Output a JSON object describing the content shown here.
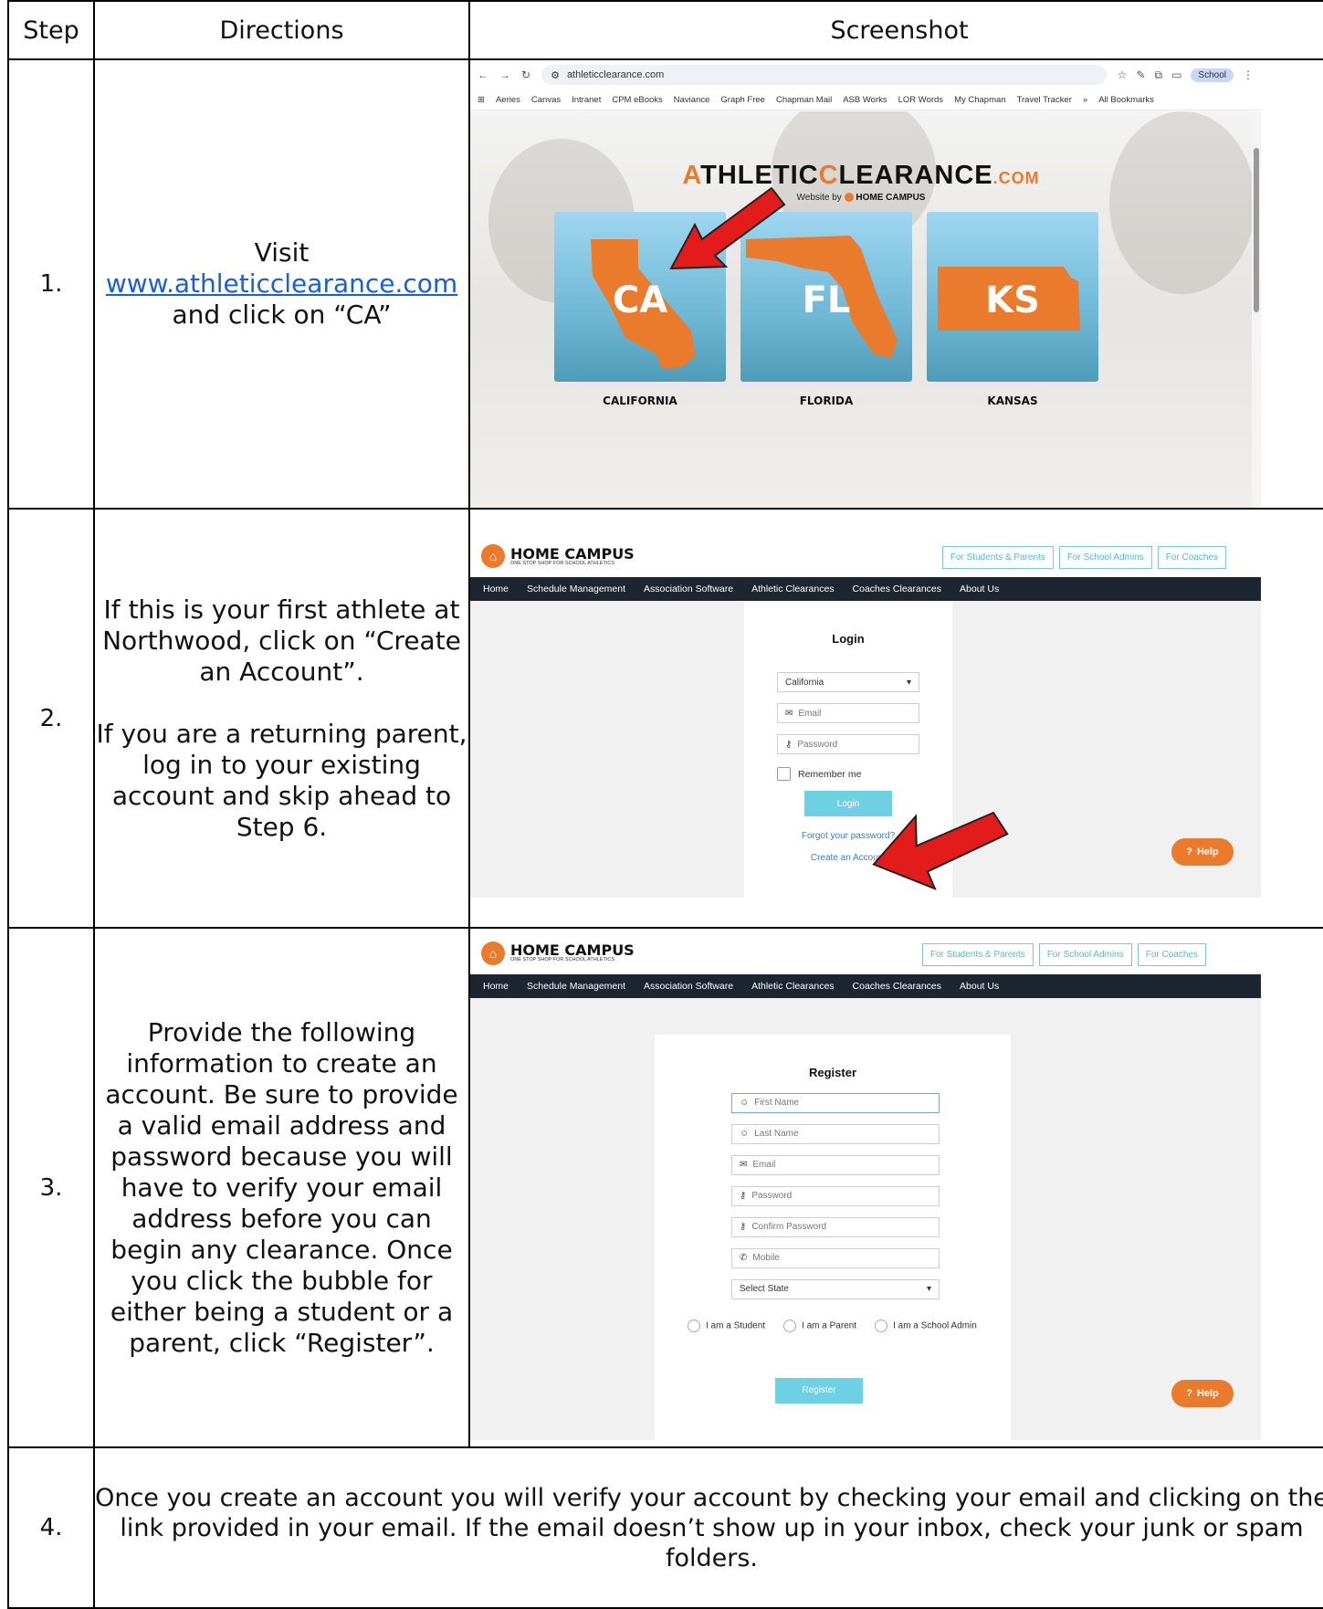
{
  "table": {
    "headers": [
      "Step",
      "Directions",
      "Screenshot"
    ],
    "rows": [
      {
        "step": "1.",
        "directions": {
          "line1": "Visit",
          "link": "www.athleticclearance.com",
          "line3": "and click on “CA”"
        }
      },
      {
        "step": "2.",
        "directions": {
          "para1": "If this is your first athlete at Northwood, click on “Create an Account”.",
          "para2": "If you are a returning parent, log in to your existing account and skip ahead to Step 6."
        }
      },
      {
        "step": "3.",
        "directions": {
          "para1": "Provide the following information to create an account. Be sure to provide a valid email address and password because you will have to verify your email address before you can begin any clearance. Once you click the bubble for either being a student or a parent, click “Register”."
        }
      },
      {
        "step": "4.",
        "directions": {
          "para1": "Once you create an account you will verify your account by checking your email and clicking on the link provided in your email. If the email doesn’t show up in your inbox, check your junk or spam folders."
        }
      }
    ]
  },
  "shot1": {
    "url": "athleticclearance.com",
    "profile": "School",
    "bookmarks": [
      "Aeries",
      "Canvas",
      "Intranet",
      "CPM eBooks",
      "Naviance",
      "Graph Free",
      "Chapman Mail",
      "ASB Works",
      "LOR Words",
      "My Chapman",
      "Travel Tracker",
      "»",
      "All Bookmarks"
    ],
    "logo": {
      "part1": "A",
      "part2": "THLETIC",
      "part3": "C",
      "part4": "LEARANCE",
      "part5": ".COM",
      "byline": "Website by",
      "byline_brand": "HOME CAMPUS"
    },
    "states": [
      {
        "abbr": "CA",
        "name": "CALIFORNIA"
      },
      {
        "abbr": "FL",
        "name": "FLORIDA"
      },
      {
        "abbr": "KS",
        "name": "KANSAS"
      }
    ],
    "colors": {
      "accent": "#ea7a2c",
      "arrow": "#e31b1b"
    }
  },
  "hc": {
    "name": "HOME CAMPUS",
    "tagline": "ONE STOP SHOP FOR SCHOOL ATHLETICS",
    "buttons": [
      "For Students & Parents",
      "For School Admins",
      "For Coaches"
    ],
    "nav": [
      "Home",
      "Schedule Management",
      "Association Software",
      "Athletic Clearances",
      "Coaches Clearances",
      "About Us"
    ],
    "help": "Help"
  },
  "login": {
    "title": "Login",
    "state": "California",
    "email": "Email",
    "password": "Password",
    "remember": "Remember me",
    "button": "Login",
    "forgot": "Forgot your password?",
    "create": "Create an Account"
  },
  "register": {
    "title": "Register",
    "first": "First Name",
    "last": "Last Name",
    "email": "Email",
    "password": "Password",
    "confirm": "Confirm Password",
    "mobile": "Mobile",
    "state": "Select State",
    "roles": [
      "I am a Student",
      "I am a Parent",
      "I am a School Admin"
    ],
    "button": "Register"
  }
}
